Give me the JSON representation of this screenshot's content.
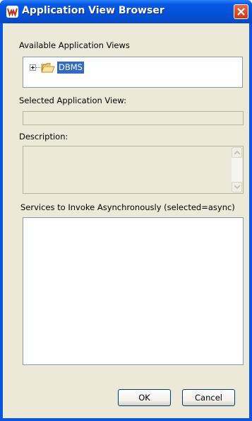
{
  "window": {
    "title": "Application View Browser"
  },
  "available_views": {
    "label": "Available Application Views",
    "tree": [
      {
        "label": "DBMS",
        "expanded": false,
        "selected": true,
        "icon": "folder-icon"
      }
    ]
  },
  "selected_view": {
    "label": "Selected Application View:",
    "value": ""
  },
  "description": {
    "label": "Description:",
    "value": ""
  },
  "services": {
    "label": "Services to Invoke Asynchronously (selected=async)",
    "items": []
  },
  "buttons": {
    "ok": "OK",
    "cancel": "Cancel"
  },
  "colors": {
    "titlebar": "#0551d8",
    "selection": "#316ac5",
    "dialog_bg": "#ece9d8",
    "close": "#c93b17"
  }
}
